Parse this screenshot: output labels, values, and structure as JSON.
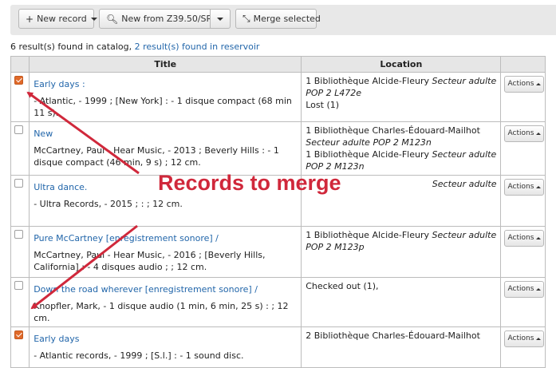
{
  "toolbar": {
    "new_record": "New record",
    "new_from": "New from Z39.50/SRU",
    "merge_selected": "Merge selected"
  },
  "summary": {
    "catalog": "6 result(s) found in catalog,",
    "reservoir": "2 result(s) found in reservoir"
  },
  "table": {
    "col_title": "Title",
    "col_location": "Location",
    "action_label": "Actions"
  },
  "rows": [
    {
      "title": "Early days :",
      "desc": "- Atlantic, - 1999 ; [New York] : - 1 disque compact (68 min 11 s).",
      "loc1": "1 Bibliothèque Alcide-Fleury",
      "loc1b": "Secteur adulte POP 2 L472e",
      "loc2": "Lost (1)",
      "loc2b": "",
      "checked": true
    },
    {
      "title": "New",
      "desc": "McCartney, Paul - Hear Music, - 2013 ; Beverly Hills : - 1 disque compact (46 min, 9 s) ; 12 cm.",
      "loc1": "1 Bibliothèque Charles-Édouard-Mailhot",
      "loc1b": "Secteur adulte POP 2 M123n",
      "loc2": "1 Bibliothèque Alcide-Fleury",
      "loc2b": "Secteur adulte POP 2 M123n",
      "checked": false
    },
    {
      "title": "Ultra dance.",
      "desc": "- Ultra Records, - 2015 ; : ; 12 cm.",
      "loc1": "",
      "loc1b": "Secteur adulte",
      "loc2": "",
      "loc2b": "",
      "checked": false
    },
    {
      "title": "Pure McCartney [enregistrement sonore] /",
      "desc": "McCartney, Paul - Hear Music, - 2016 ; [Beverly Hills, California] : - 4 disques audio ; ; 12 cm.",
      "loc1": "1 Bibliothèque Alcide-Fleury",
      "loc1b": "Secteur adulte POP 2 M123p",
      "loc2": "",
      "loc2b": "",
      "checked": false
    },
    {
      "title": "Down the road wherever [enregistrement sonore] /",
      "desc": "Knopfler, Mark, - 1 disque audio (1 min, 6 min, 25 s) : ; 12 cm.",
      "loc1": "Checked out (1),",
      "loc1b": "",
      "loc2": "",
      "loc2b": "",
      "checked": false
    },
    {
      "title": "Early days",
      "desc": "- Atlantic records, - 1999 ; [S.l.] : - 1 sound disc.",
      "loc1": "2 Bibliothèque Charles-Édouard-Mailhot",
      "loc1b": "",
      "loc2": "",
      "loc2b": "",
      "checked": true
    }
  ],
  "annotation": {
    "text": "Records to merge",
    "color": "#d0283b"
  }
}
